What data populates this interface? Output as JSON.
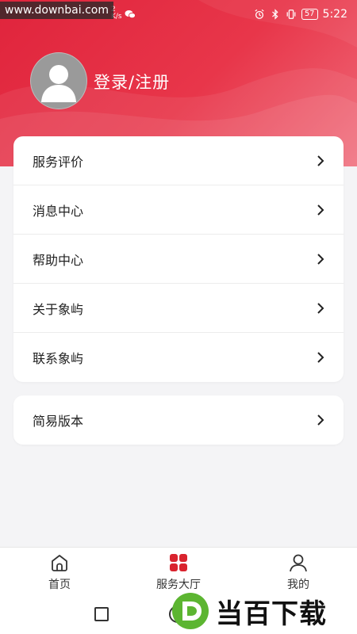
{
  "watermark_top": "www.downbai.com",
  "status_bar": {
    "left_fragment": "2\nK/s",
    "battery": "57",
    "time": "5:22"
  },
  "profile": {
    "login_label": "登录/注册"
  },
  "menu": {
    "items": [
      {
        "label": "服务评价"
      },
      {
        "label": "消息中心"
      },
      {
        "label": "帮助中心"
      },
      {
        "label": "关于象屿"
      },
      {
        "label": "联系象屿"
      }
    ],
    "version_item": {
      "label": "简易版本"
    }
  },
  "tabbar": {
    "home": "首页",
    "service": "服务大厅",
    "mine": "我的"
  },
  "watermark_bottom": "当百下载",
  "colors": {
    "header_red": "#e0243c",
    "accent_red": "#d9232e"
  }
}
